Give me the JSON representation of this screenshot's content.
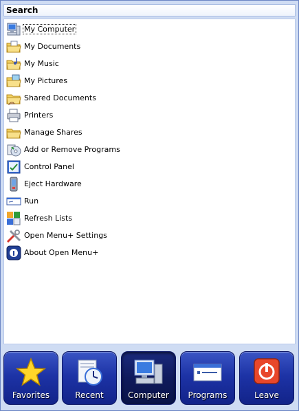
{
  "search": {
    "label": "Search"
  },
  "items": [
    {
      "label": "My Computer",
      "icon": "my-computer-icon",
      "selected": true
    },
    {
      "label": "My Documents",
      "icon": "documents-folder-icon"
    },
    {
      "label": "My Music",
      "icon": "music-folder-icon"
    },
    {
      "label": "My Pictures",
      "icon": "pictures-folder-icon"
    },
    {
      "label": "Shared Documents",
      "icon": "shared-folder-icon"
    },
    {
      "label": "Printers",
      "icon": "printer-icon"
    },
    {
      "label": "Manage Shares",
      "icon": "shares-folder-icon"
    },
    {
      "label": "Add or Remove Programs",
      "icon": "add-remove-programs-icon"
    },
    {
      "label": "Control Panel",
      "icon": "control-panel-icon"
    },
    {
      "label": "Eject Hardware",
      "icon": "eject-hardware-icon"
    },
    {
      "label": "Run",
      "icon": "run-icon"
    },
    {
      "label": "Refresh Lists",
      "icon": "refresh-icon"
    },
    {
      "label": "Open Menu+ Settings",
      "icon": "settings-tools-icon"
    },
    {
      "label": "About Open Menu+",
      "icon": "about-icon"
    }
  ],
  "dock": [
    {
      "label": "Favorites",
      "icon": "star-icon"
    },
    {
      "label": "Recent",
      "icon": "clock-document-icon"
    },
    {
      "label": "Computer",
      "icon": "computer-icon",
      "active": true
    },
    {
      "label": "Programs",
      "icon": "programs-window-icon"
    },
    {
      "label": "Leave",
      "icon": "power-icon"
    }
  ]
}
